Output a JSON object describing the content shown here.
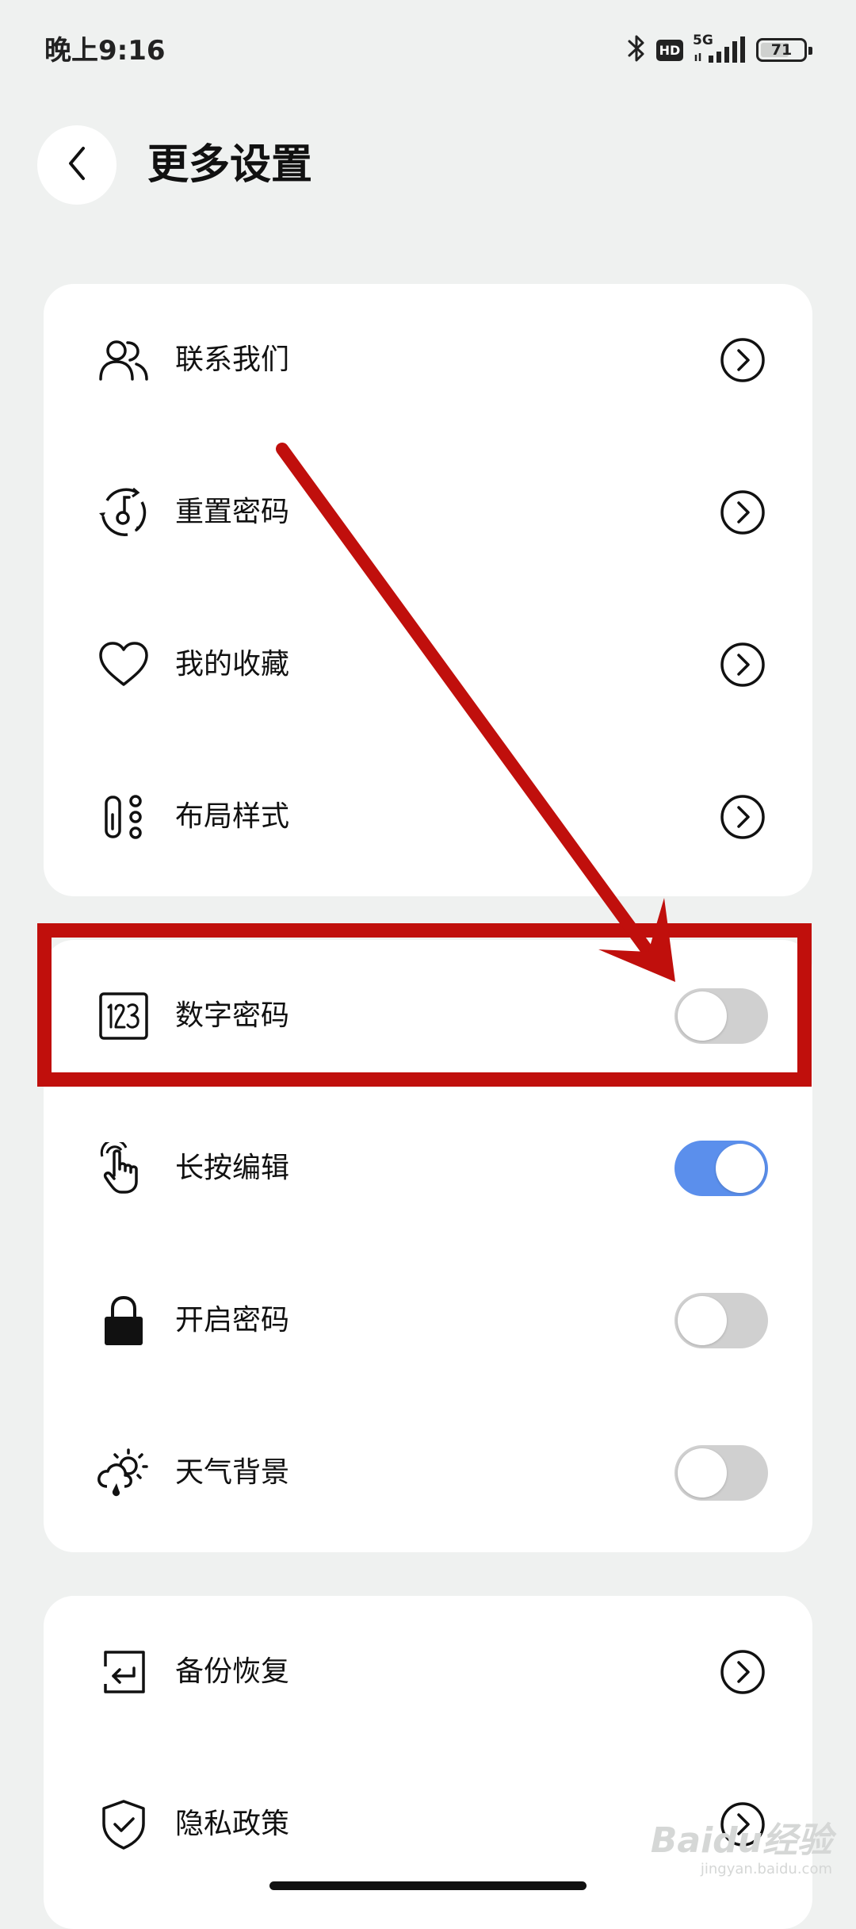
{
  "status_bar": {
    "time": "晚上9:16",
    "hd_badge": "HD",
    "network": "5G",
    "battery": "71",
    "battery_level": 0.71,
    "icons": [
      "bluetooth-icon",
      "hd-icon",
      "signal-5g-icon",
      "battery-icon"
    ]
  },
  "header": {
    "title": "更多设置"
  },
  "card1": {
    "items": [
      {
        "label": "联系我们",
        "icon": "contact-users-icon"
      },
      {
        "label": "重置密码",
        "icon": "reset-password-icon"
      },
      {
        "label": "我的收藏",
        "icon": "heart-icon"
      },
      {
        "label": "布局样式",
        "icon": "layout-style-icon"
      }
    ]
  },
  "card2": {
    "items": [
      {
        "label": "数字密码",
        "icon": "digits-123-icon",
        "enabled": false
      },
      {
        "label": "长按编辑",
        "icon": "hand-pointer-icon",
        "enabled": true
      },
      {
        "label": "开启密码",
        "icon": "lock-icon",
        "enabled": false
      },
      {
        "label": "天气背景",
        "icon": "weather-icon",
        "enabled": false
      }
    ]
  },
  "card3": {
    "items": [
      {
        "label": "备份恢复",
        "icon": "backup-restore-icon"
      },
      {
        "label": "隐私政策",
        "icon": "shield-check-icon"
      }
    ]
  },
  "colors": {
    "background": "#eff1f0",
    "card": "#ffffff",
    "toggle_on": "#5b8fec",
    "toggle_off": "#d0d0d0",
    "annotation": "#c00f0c"
  },
  "watermark": {
    "main": "Baidu经验",
    "sub": "jingyan.baidu.com"
  }
}
